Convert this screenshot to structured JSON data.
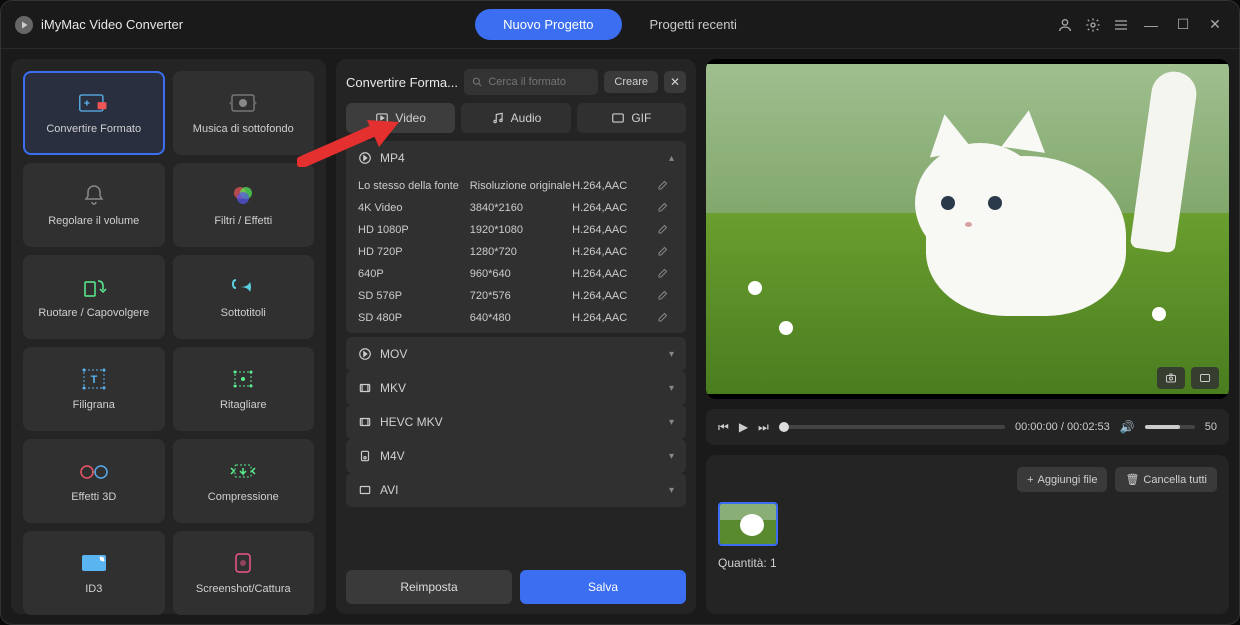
{
  "app": {
    "title": "iMyMac Video Converter"
  },
  "titlebar": {
    "tabs": {
      "new": "Nuovo Progetto",
      "recent": "Progetti recenti"
    }
  },
  "sidebar": {
    "tools": [
      {
        "label": "Convertire Formato",
        "icon": "convert"
      },
      {
        "label": "Musica di sottofondo",
        "icon": "music"
      },
      {
        "label": "Regolare il volume",
        "icon": "volume"
      },
      {
        "label": "Filtri / Effetti",
        "icon": "filter"
      },
      {
        "label": "Ruotare / Capovolgere",
        "icon": "rotate"
      },
      {
        "label": "Sottotitoli",
        "icon": "subtitle"
      },
      {
        "label": "Filigrana",
        "icon": "watermark"
      },
      {
        "label": "Ritagliare",
        "icon": "crop"
      },
      {
        "label": "Effetti 3D",
        "icon": "3d"
      },
      {
        "label": "Compressione",
        "icon": "compress"
      },
      {
        "label": "ID3",
        "icon": "id3"
      },
      {
        "label": "Screenshot/Cattura",
        "icon": "screenshot"
      }
    ]
  },
  "middle": {
    "title": "Convertire Forma...",
    "search_placeholder": "Cerca il formato",
    "create": "Creare",
    "tabs": {
      "video": "Video",
      "audio": "Audio",
      "gif": "GIF"
    },
    "mp4": {
      "name": "MP4",
      "presets": [
        {
          "name": "Lo stesso della fonte",
          "res": "Risoluzione originale",
          "codec": "H.264,AAC"
        },
        {
          "name": "4K Video",
          "res": "3840*2160",
          "codec": "H.264,AAC"
        },
        {
          "name": "HD 1080P",
          "res": "1920*1080",
          "codec": "H.264,AAC"
        },
        {
          "name": "HD 720P",
          "res": "1280*720",
          "codec": "H.264,AAC"
        },
        {
          "name": "640P",
          "res": "960*640",
          "codec": "H.264,AAC"
        },
        {
          "name": "SD 576P",
          "res": "720*576",
          "codec": "H.264,AAC"
        },
        {
          "name": "SD 480P",
          "res": "640*480",
          "codec": "H.264,AAC"
        }
      ]
    },
    "groups": [
      "MOV",
      "MKV",
      "HEVC MKV",
      "M4V",
      "AVI"
    ],
    "reset": "Reimposta",
    "save": "Salva"
  },
  "player": {
    "time": "00:00:00 / 00:02:53",
    "volume": "50"
  },
  "bottom": {
    "add": "Aggiungi file",
    "clear": "Cancella tutti",
    "qty_label": "Quantità:",
    "qty_value": "1"
  }
}
